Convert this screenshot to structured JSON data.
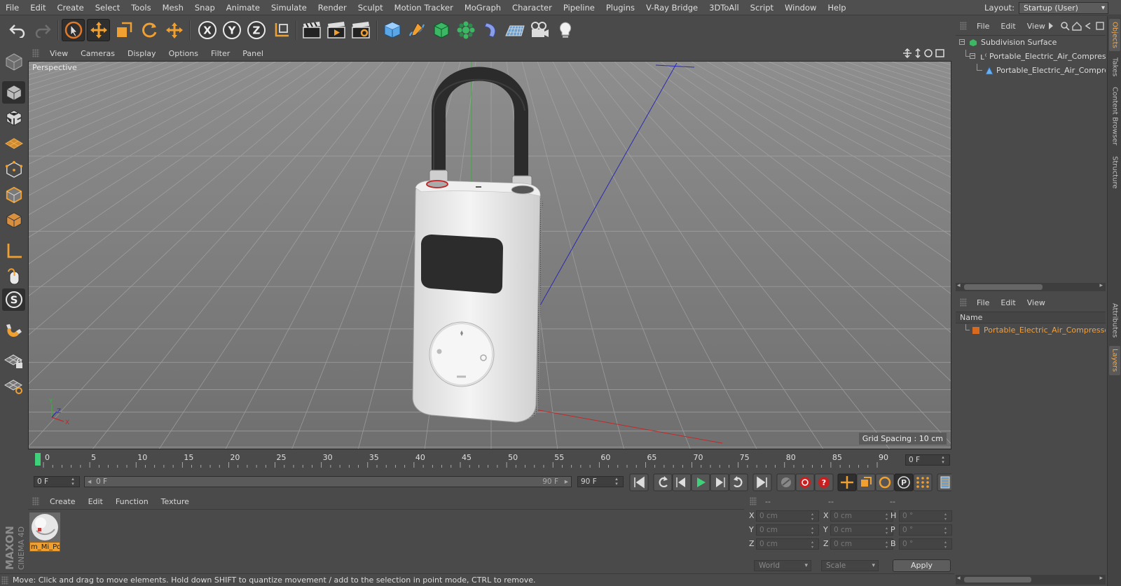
{
  "menubar": {
    "items": [
      "File",
      "Edit",
      "Create",
      "Select",
      "Tools",
      "Mesh",
      "Snap",
      "Animate",
      "Simulate",
      "Render",
      "Sculpt",
      "Motion Tracker",
      "MoGraph",
      "Character",
      "Pipeline",
      "Plugins",
      "V-Ray Bridge",
      "3DToAll",
      "Script",
      "Window",
      "Help"
    ],
    "layout_label": "Layout:",
    "layout_value": "Startup (User)"
  },
  "viewport": {
    "menu": [
      "View",
      "Cameras",
      "Display",
      "Options",
      "Filter",
      "Panel"
    ],
    "label": "Perspective",
    "grid_spacing": "Grid Spacing : 10 cm",
    "axis_labels": {
      "y": "Y",
      "z": "Z",
      "x": "X"
    }
  },
  "timeline": {
    "ticks": [
      "0",
      "5",
      "10",
      "15",
      "20",
      "25",
      "30",
      "35",
      "40",
      "45",
      "50",
      "55",
      "60",
      "65",
      "70",
      "75",
      "80",
      "85",
      "90"
    ],
    "current_frame": "0 F",
    "start_field": "0 F",
    "range_start": "0 F",
    "range_end_inner": "90 F",
    "end_field": "90 F"
  },
  "material_manager": {
    "menu": [
      "Create",
      "Edit",
      "Function",
      "Texture"
    ],
    "material_name": "m_Mi_Po"
  },
  "coordinates": {
    "headers": [
      "--",
      "--",
      "--"
    ],
    "rows": [
      {
        "a_label": "X",
        "a_val": "0 cm",
        "b_label": "X",
        "b_val": "0 cm",
        "c_label": "H",
        "c_val": "0 °"
      },
      {
        "a_label": "Y",
        "a_val": "0 cm",
        "b_label": "Y",
        "b_val": "0 cm",
        "c_label": "P",
        "c_val": "0 °"
      },
      {
        "a_label": "Z",
        "a_val": "0 cm",
        "b_label": "Z",
        "b_val": "0 cm",
        "c_label": "B",
        "c_val": "0 °"
      }
    ],
    "world_dropdown": "World",
    "scale_dropdown": "Scale",
    "apply_label": "Apply"
  },
  "status": {
    "text": "Move: Click and drag to move elements. Hold down SHIFT to quantize movement / add to the selection in point mode, CTRL to remove."
  },
  "objects_panel": {
    "menu": [
      "File",
      "Edit",
      "View"
    ],
    "tree": [
      "Subdivision Surface",
      "Portable_Electric_Air_Compressor",
      "Portable_Electric_Air_Compressor"
    ]
  },
  "layers_panel": {
    "menu": [
      "File",
      "Edit",
      "View"
    ],
    "column": "Name",
    "row": "Portable_Electric_Air_Compressor"
  },
  "side_tabs": [
    "Objects",
    "Takes",
    "Content Browser",
    "Structure",
    "Attributes",
    "Layers"
  ],
  "logo": {
    "line1": "MAXON",
    "line2": "CINEMA 4D"
  },
  "colors": {
    "accent": "#f0a040",
    "selection": "#5b5b5b",
    "panel_bg": "#4a4a4a",
    "viewport_bg": "#7d7d7d"
  }
}
